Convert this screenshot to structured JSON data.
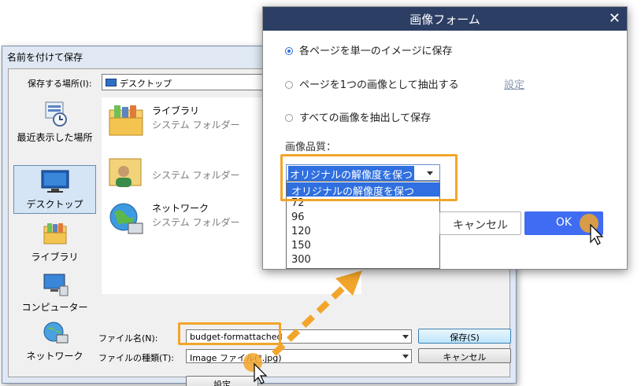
{
  "save_dialog": {
    "title": "名前を付けて保存",
    "location_label": "保存する場所(I):",
    "location_value": "デスクトップ",
    "places": [
      {
        "label": "最近表示した場所",
        "icon": "recent-places-icon"
      },
      {
        "label": "デスクトップ",
        "icon": "desktop-icon",
        "selected": true
      },
      {
        "label": "ライブラリ",
        "icon": "libraries-icon"
      },
      {
        "label": "コンピューター",
        "icon": "computer-icon"
      },
      {
        "label": "ネットワーク",
        "icon": "network-icon"
      }
    ],
    "files": [
      {
        "name": "ライブラリ",
        "sub": "システム フォルダー",
        "icon": "library-folder-icon"
      },
      {
        "name": "",
        "sub": "システム フォルダー",
        "icon": "user-folder-icon"
      },
      {
        "name": "ネットワーク",
        "sub": "システム フォルダー",
        "icon": "network-globe-icon"
      }
    ],
    "filename_label": "ファイル名(N):",
    "filename_value": "budget-formattached",
    "filetype_label": "ファイルの種類(T):",
    "filetype_value": "Image ファイル(*.jpg)",
    "save_button": "保存(S)",
    "cancel_button": "キャンセル",
    "settings_button": "設定"
  },
  "image_dialog": {
    "title": "画像フォーム",
    "close_glyph": "✕",
    "options": [
      {
        "label": "各ページを単一のイメージに保存",
        "checked": true
      },
      {
        "label": "ページを1つの画像として抽出する",
        "checked": false
      },
      {
        "label": "すべての画像を抽出して保存",
        "checked": false
      }
    ],
    "settings_link": "設定",
    "quality_label": "画像品質：",
    "quality_selected": "オリジナルの解像度を保つ",
    "quality_options": [
      "オリジナルの解像度を保つ",
      "72",
      "96",
      "120",
      "150",
      "300"
    ],
    "cancel_button": "キャンセル",
    "ok_button": "OK"
  },
  "colors": {
    "accent_orange": "#f2a52a",
    "title_bar": "#2c3e64",
    "ok_blue": "#3f6cf2",
    "selection_blue": "#2f6fe0"
  }
}
